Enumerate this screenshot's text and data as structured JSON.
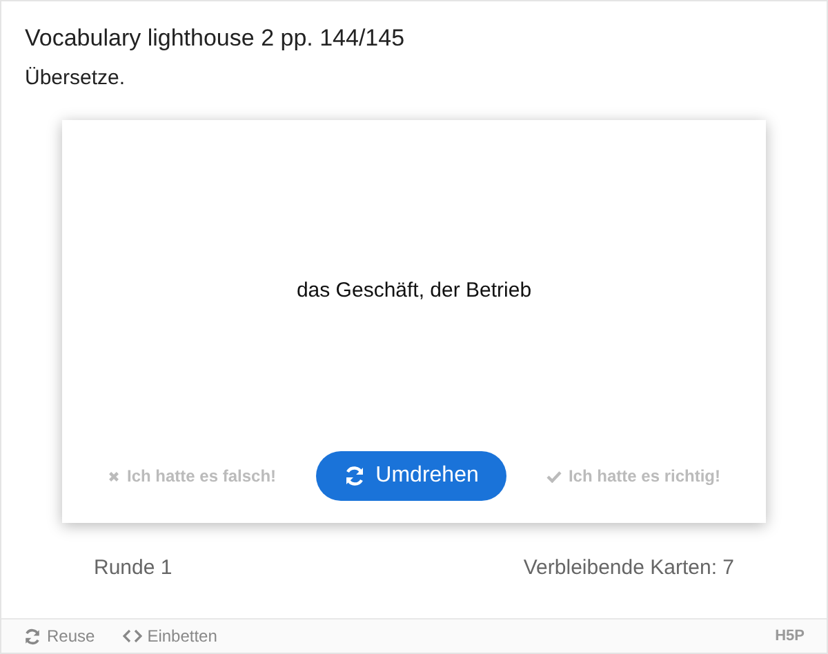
{
  "title": "Vocabulary lighthouse 2 pp. 144/145",
  "instruction": "Übersetze.",
  "card": {
    "text": "das Geschäft, der Betrieb"
  },
  "actions": [
    {
      "kind": "wrong",
      "label": "Ich hatte es falsch!",
      "disabled": true
    },
    {
      "kind": "flip",
      "label": "Umdrehen",
      "disabled": false
    },
    {
      "kind": "right",
      "label": "Ich hatte es richtig!",
      "disabled": true
    }
  ],
  "round": "Runde 1",
  "remaining": "Verbleibende Karten: 7",
  "footer": {
    "links": [
      {
        "kind": "reuse",
        "label": "Reuse"
      },
      {
        "kind": "embed",
        "label": "Einbetten"
      }
    ],
    "logo": "H5P"
  }
}
